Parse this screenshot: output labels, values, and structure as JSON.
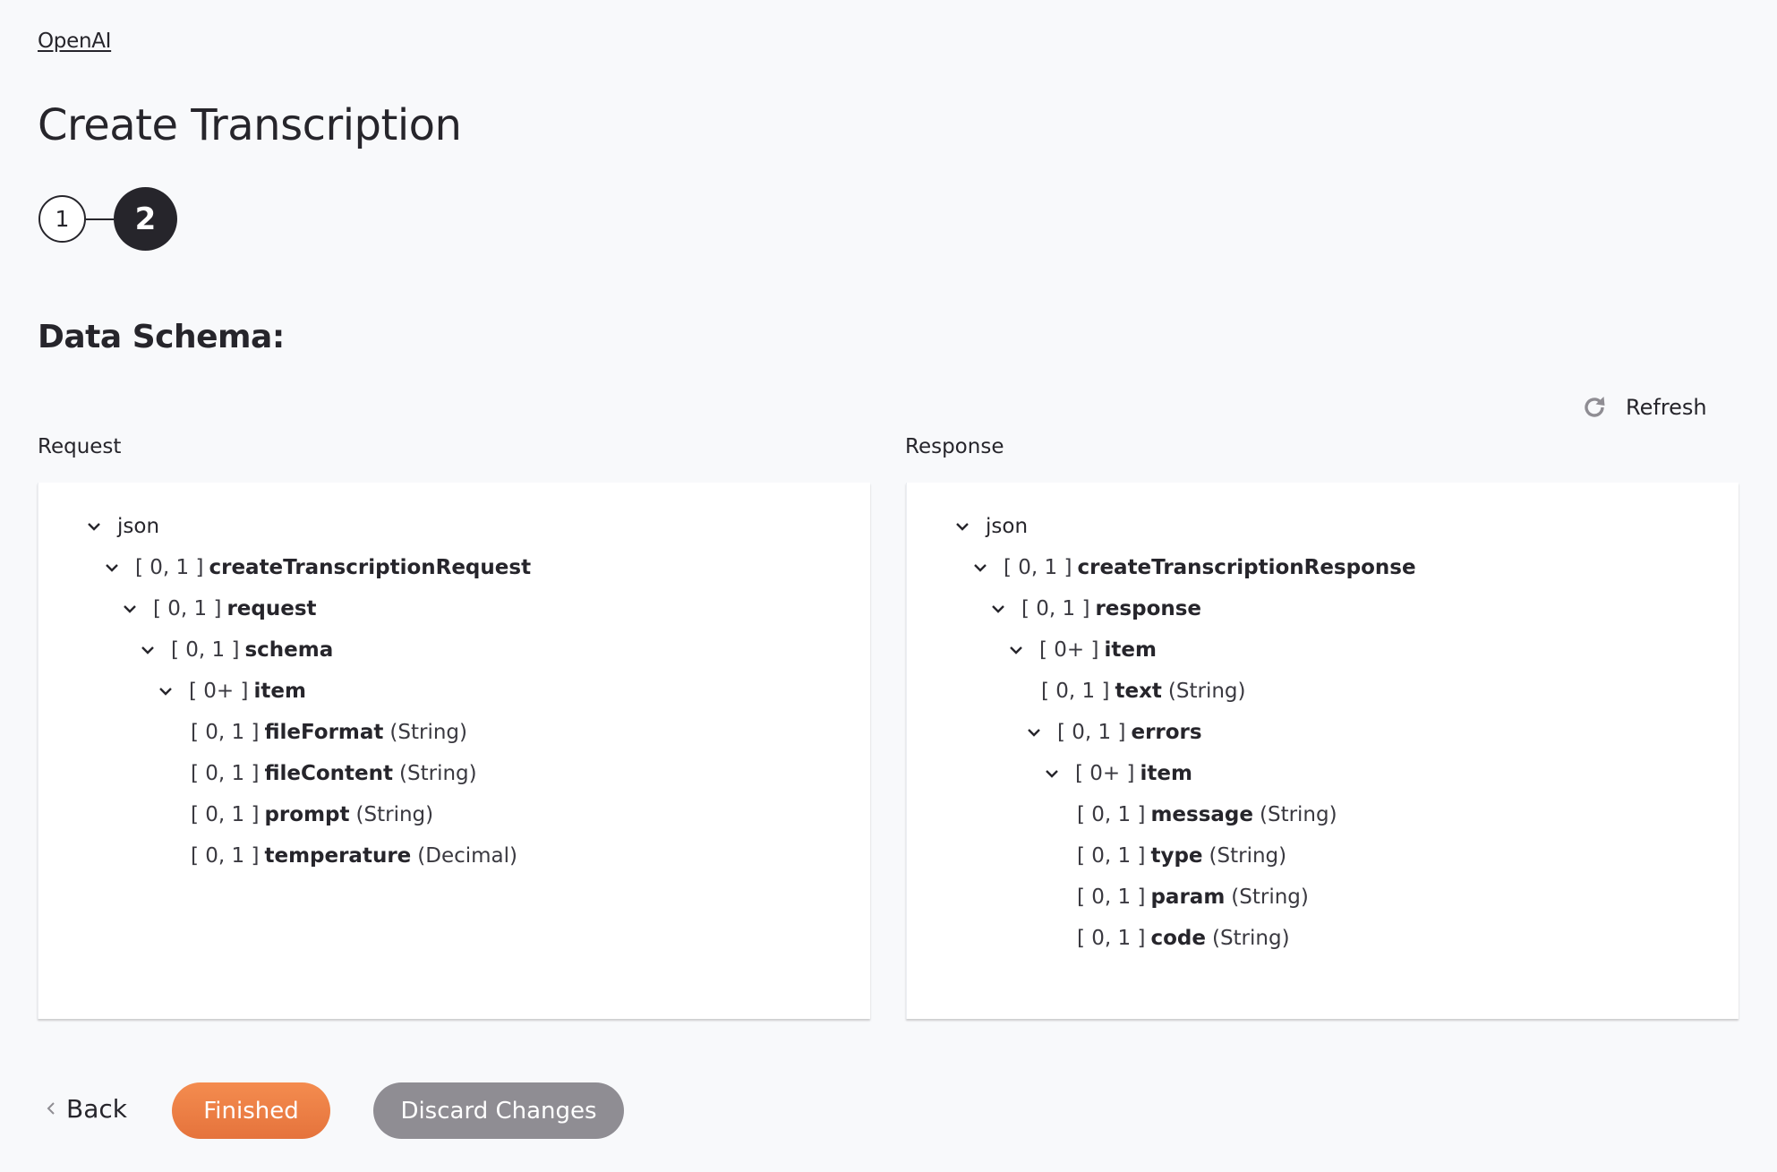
{
  "breadcrumb": {
    "label": "OpenAI"
  },
  "page": {
    "title": "Create Transcription"
  },
  "stepper": {
    "steps": [
      {
        "number": "1",
        "state": "completed"
      },
      {
        "number": "2",
        "state": "current"
      }
    ]
  },
  "section": {
    "title": "Data Schema:"
  },
  "refresh": {
    "label": "Refresh",
    "icon": "refresh-icon"
  },
  "request": {
    "label": "Request",
    "tree": [
      {
        "depth": 0,
        "expandable": true,
        "expanded": true,
        "cardinality": "",
        "name": "json",
        "type": "",
        "root": true
      },
      {
        "depth": 1,
        "expandable": true,
        "expanded": true,
        "cardinality": "[ 0, 1 ]",
        "name": "createTranscriptionRequest",
        "type": ""
      },
      {
        "depth": 2,
        "expandable": true,
        "expanded": true,
        "cardinality": "[ 0, 1 ]",
        "name": "request",
        "type": ""
      },
      {
        "depth": 3,
        "expandable": true,
        "expanded": true,
        "cardinality": "[ 0, 1 ]",
        "name": "schema",
        "type": ""
      },
      {
        "depth": 4,
        "expandable": true,
        "expanded": true,
        "cardinality": "[ 0+ ]",
        "name": "item",
        "type": ""
      },
      {
        "depth": 5,
        "expandable": false,
        "cardinality": "[ 0, 1 ]",
        "name": "fileFormat",
        "type": "(String)"
      },
      {
        "depth": 5,
        "expandable": false,
        "cardinality": "[ 0, 1 ]",
        "name": "fileContent",
        "type": "(String)"
      },
      {
        "depth": 5,
        "expandable": false,
        "cardinality": "[ 0, 1 ]",
        "name": "prompt",
        "type": "(String)"
      },
      {
        "depth": 5,
        "expandable": false,
        "cardinality": "[ 0, 1 ]",
        "name": "temperature",
        "type": "(Decimal)"
      }
    ]
  },
  "response": {
    "label": "Response",
    "tree": [
      {
        "depth": 0,
        "expandable": true,
        "expanded": true,
        "cardinality": "",
        "name": "json",
        "type": "",
        "root": true
      },
      {
        "depth": 1,
        "expandable": true,
        "expanded": true,
        "cardinality": "[ 0, 1 ]",
        "name": "createTranscriptionResponse",
        "type": ""
      },
      {
        "depth": 2,
        "expandable": true,
        "expanded": true,
        "cardinality": "[ 0, 1 ]",
        "name": "response",
        "type": ""
      },
      {
        "depth": 3,
        "expandable": true,
        "expanded": true,
        "cardinality": "[ 0+ ]",
        "name": "item",
        "type": ""
      },
      {
        "depth": 4,
        "expandable": false,
        "cardinality": "[ 0, 1 ]",
        "name": "text",
        "type": "(String)"
      },
      {
        "depth": 4,
        "expandable": true,
        "expanded": true,
        "cardinality": "[ 0, 1 ]",
        "name": "errors",
        "type": ""
      },
      {
        "depth": 5,
        "expandable": true,
        "expanded": true,
        "cardinality": "[ 0+ ]",
        "name": "item",
        "type": ""
      },
      {
        "depth": 6,
        "expandable": false,
        "cardinality": "[ 0, 1 ]",
        "name": "message",
        "type": "(String)"
      },
      {
        "depth": 6,
        "expandable": false,
        "cardinality": "[ 0, 1 ]",
        "name": "type",
        "type": "(String)"
      },
      {
        "depth": 6,
        "expandable": false,
        "cardinality": "[ 0, 1 ]",
        "name": "param",
        "type": "(String)"
      },
      {
        "depth": 6,
        "expandable": false,
        "cardinality": "[ 0, 1 ]",
        "name": "code",
        "type": "(String)"
      }
    ]
  },
  "footer": {
    "back_label": "Back",
    "finished_label": "Finished",
    "discard_label": "Discard Changes"
  },
  "colors": {
    "primary_button": "#ee8146",
    "secondary_button": "#8f8d93",
    "text": "#26252b",
    "background": "#f8f9fb"
  }
}
